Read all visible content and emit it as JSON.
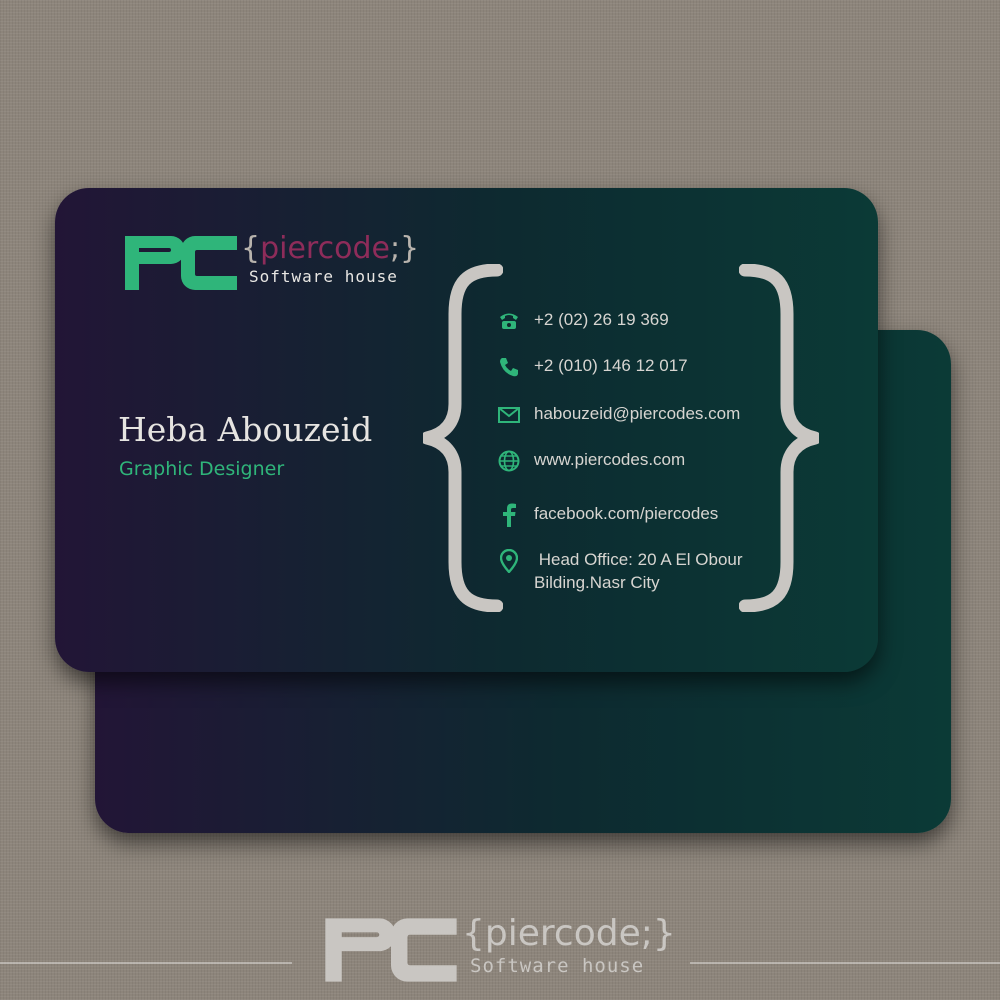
{
  "colors": {
    "accent_green": "#2fb57a",
    "accent_magenta": "#8e2c5a",
    "card_dark": "#221536",
    "card_teal": "#0b3a36",
    "background": "#8d857b"
  },
  "brand": {
    "mark": "PC",
    "brace_open": "{",
    "name": "piercode",
    "brace_close": ";}",
    "tagline": "Software house"
  },
  "person": {
    "name": "Heba Abouzeid",
    "title": "Graphic Designer"
  },
  "contacts": [
    {
      "icon": "telephone-icon",
      "text": "+2 (02) 26 19 369"
    },
    {
      "icon": "phone-icon",
      "text": "+2 (010) 146 12 017"
    },
    {
      "icon": "envelope-icon",
      "text": "habouzeid@piercodes.com"
    },
    {
      "icon": "globe-icon",
      "text": "www.piercodes.com"
    },
    {
      "icon": "facebook-icon",
      "text": "facebook.com/piercodes"
    },
    {
      "icon": "location-pin-icon",
      "text": " Head Office: 20 A El Obour",
      "text2": "Bilding.Nasr City"
    }
  ]
}
